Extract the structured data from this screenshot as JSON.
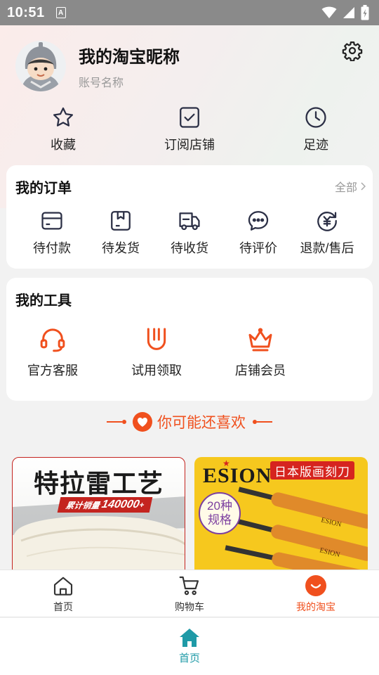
{
  "status_bar": {
    "time": "10:51",
    "indicator": "A",
    "icons": [
      "wifi-icon",
      "signal-icon",
      "battery-icon"
    ]
  },
  "profile": {
    "nickname": "我的淘宝昵称",
    "account_name": "账号名称"
  },
  "quick_links": [
    {
      "label": "收藏",
      "icon": "star-icon"
    },
    {
      "label": "订阅店铺",
      "icon": "subscribe-store-icon"
    },
    {
      "label": "足迹",
      "icon": "clock-icon"
    }
  ],
  "orders": {
    "title": "我的订单",
    "view_all": "全部",
    "items": [
      {
        "label": "待付款",
        "icon": "wallet-icon"
      },
      {
        "label": "待发货",
        "icon": "package-icon"
      },
      {
        "label": "待收货",
        "icon": "truck-icon"
      },
      {
        "label": "待评价",
        "icon": "chat-bubble-icon"
      },
      {
        "label": "退款/售后",
        "icon": "refund-icon"
      }
    ]
  },
  "tools": {
    "title": "我的工具",
    "items": [
      {
        "label": "官方客服",
        "icon": "headset-icon"
      },
      {
        "label": "试用领取",
        "icon": "trial-icon"
      },
      {
        "label": "店铺会员",
        "icon": "crown-icon"
      }
    ]
  },
  "recommend": {
    "title": "你可能还喜欢"
  },
  "products": [
    {
      "title": "特拉雷工艺",
      "badge_text": "累计销量",
      "badge_number": "140000",
      "badge_suffix": "+"
    },
    {
      "brand": "ESION",
      "tag": "日本版画刻刀",
      "spec": "20种规格",
      "knife_mark": "ESION"
    }
  ],
  "tab_bar": [
    {
      "label": "首页",
      "icon": "home-outline-icon",
      "active": false
    },
    {
      "label": "购物车",
      "icon": "cart-icon",
      "active": false
    },
    {
      "label": "我的淘宝",
      "icon": "taobao-mine-icon",
      "active": true
    }
  ],
  "bottom_nav": {
    "label": "首页",
    "icon": "home-filled-icon"
  },
  "colors": {
    "accent": "#f0501e",
    "teal": "#1f9aa7",
    "status_bar": "#8a8a8a"
  }
}
